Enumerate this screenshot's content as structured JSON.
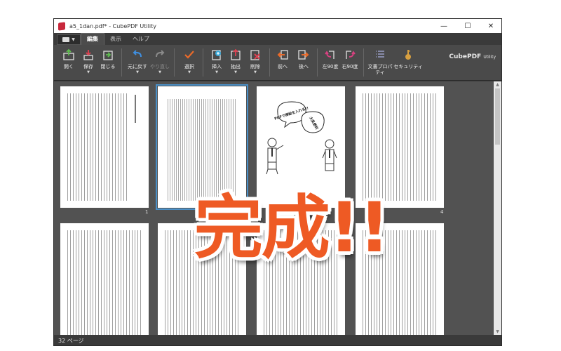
{
  "window": {
    "title": "a5_1dan.pdf* - CubePDF Utility",
    "controls": {
      "minimize": "—",
      "maximize": "☐",
      "close": "✕"
    }
  },
  "menu": {
    "tabs": [
      {
        "label": "編集",
        "active": true
      },
      {
        "label": "表示",
        "active": false
      },
      {
        "label": "ヘルプ",
        "active": false
      }
    ]
  },
  "ribbon": {
    "buttons": [
      {
        "label": "開く",
        "icon": "open-icon",
        "color": "#5fbf4f"
      },
      {
        "label": "保存",
        "icon": "save-icon",
        "color": "#e04050",
        "has_dropdown": true
      },
      {
        "label": "閉じる",
        "icon": "close-file-icon",
        "color": "#5fbf4f"
      },
      {
        "label": "元に戻す",
        "icon": "undo-icon",
        "color": "#3f8fe0",
        "has_dropdown": true
      },
      {
        "label": "やり直し",
        "icon": "redo-icon",
        "color": "#8a8a8a",
        "disabled": true,
        "has_dropdown": true
      },
      {
        "label": "選択",
        "icon": "select-check-icon",
        "color": "#e86a2a",
        "has_dropdown": true
      },
      {
        "label": "挿入",
        "icon": "insert-icon",
        "color": "#38a8d8",
        "has_dropdown": true
      },
      {
        "label": "抽出",
        "icon": "extract-icon",
        "color": "#e04050",
        "has_dropdown": true
      },
      {
        "label": "削除",
        "icon": "delete-icon",
        "color": "#e04050",
        "has_dropdown": true
      },
      {
        "label": "前へ",
        "icon": "move-back-icon",
        "color": "#e86a2a"
      },
      {
        "label": "後へ",
        "icon": "move-forward-icon",
        "color": "#e86a2a"
      },
      {
        "label": "左90度",
        "icon": "rotate-left-icon",
        "color": "#d84080"
      },
      {
        "label": "右90度",
        "icon": "rotate-right-icon",
        "color": "#d84080"
      },
      {
        "label": "文書プロパティ",
        "icon": "properties-icon",
        "color": "#9aa0c8"
      },
      {
        "label": "セキュリティ",
        "icon": "security-key-icon",
        "color": "#d8a040"
      }
    ],
    "brand": {
      "main": "CubePDF",
      "sub": "Utility"
    }
  },
  "pages": [
    {
      "number": "1",
      "selected": false
    },
    {
      "number": "",
      "selected": true
    },
    {
      "number": "",
      "selected": false
    },
    {
      "number": "4",
      "selected": false
    }
  ],
  "illustration": {
    "bubble_left": "PDFで挿絵を入れる!!",
    "bubble_right": "大変便利"
  },
  "overlay_text": "完成!!",
  "status": {
    "page_count": "32 ページ"
  },
  "colors": {
    "overlay": "#ee5a24",
    "selection": "#4a90c8",
    "background": "#525252"
  }
}
